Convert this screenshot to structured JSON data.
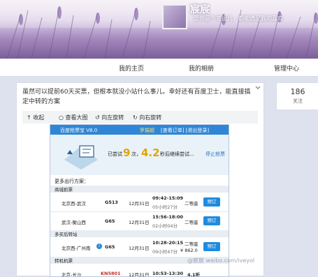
{
  "profile": {
    "name": "宸宸",
    "bio": "愿你是个幸运儿，都能遇见我的喜欢"
  },
  "nav": {
    "home": "我的主页",
    "album": "我的相册",
    "manage": "管理中心"
  },
  "post": {
    "text": "虽然可以提前60天买票，但根本就没小站什么事儿。幸好还有百度卫士，能直接搞定中转的方案",
    "toolbar": {
      "collapse": "↑ 收起",
      "view_large": "查看大图",
      "rotate_left": "向左旋转",
      "rotate_right": "向右旋转"
    }
  },
  "screenshot": {
    "title": "百度抢票宝  V8.0",
    "user": "罗振超",
    "links": "[查看订单] [退出登录]",
    "tried_label": "已尝试",
    "tried_count": "9",
    "times_unit": "次，",
    "seconds": "4.2",
    "retry_text": "秒后继续尝试...",
    "stop": "停止抢票",
    "plans_title": "更多出行方案：",
    "section_direct": "商城抓票",
    "section_transfer": "多买后转站",
    "section_flight": "转机机票",
    "rows": [
      {
        "route": "北京西-武汉",
        "train": "G513",
        "date": "12月31日",
        "time": "09:42-15:09",
        "duration": "05小时27分",
        "seat": "二等座",
        "price": "",
        "action": "预订"
      },
      {
        "route": "武汉-衡山西",
        "train": "G65",
        "date": "12月31日",
        "time": "15:56-18:00",
        "duration": "02小时04分",
        "seat": "二等座",
        "price": "",
        "action": "预订"
      },
      {
        "route": "北京西-广州南",
        "train": "G65",
        "date": "12月31日",
        "time": "10:28-20:15",
        "duration": "09小时47分",
        "seat": "二等座",
        "price": "¥ 862.0",
        "action": "预订"
      },
      {
        "route": "北京-长沙",
        "train": "KN5801",
        "date": "12月31日",
        "time": "10:53-13:30",
        "duration": "",
        "seat": "4.1折",
        "price": "",
        "action": ""
      }
    ]
  },
  "sidebar": {
    "count": "186",
    "label": "关注"
  },
  "watermark": "@宸宸  weibo.com/iveyol"
}
